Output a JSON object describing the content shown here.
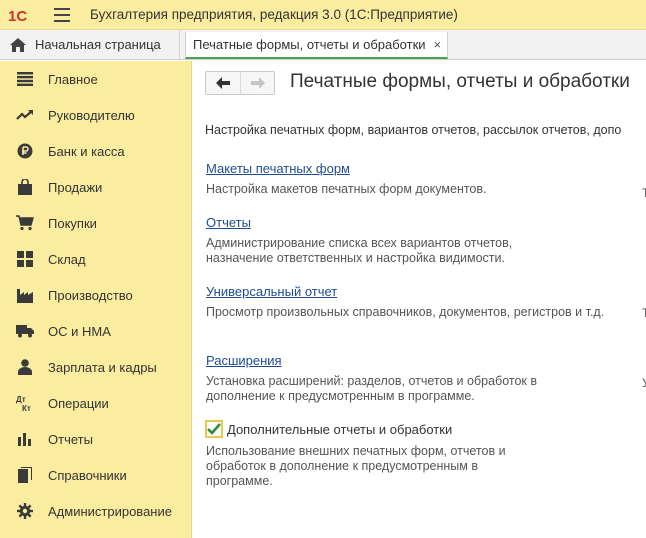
{
  "window": {
    "logo_text": "1С",
    "title": "Бухгалтерия предприятия, редакция 3.0  (1С:Предприятие)"
  },
  "tabs": {
    "home_label": "Начальная страница",
    "active_label": "Печатные формы, отчеты и обработки",
    "close_symbol": "×"
  },
  "sidebar": {
    "items": [
      {
        "label": "Главное",
        "icon": "menu-lines-icon"
      },
      {
        "label": "Руководителю",
        "icon": "trend-icon"
      },
      {
        "label": "Банк и касса",
        "icon": "ruble-coin-icon"
      },
      {
        "label": "Продажи",
        "icon": "shopping-bag-icon"
      },
      {
        "label": "Покупки",
        "icon": "cart-icon"
      },
      {
        "label": "Склад",
        "icon": "warehouse-grid-icon"
      },
      {
        "label": "Производство",
        "icon": "factory-icon"
      },
      {
        "label": "ОС и НМА",
        "icon": "truck-icon"
      },
      {
        "label": "Зарплата и кадры",
        "icon": "person-icon"
      },
      {
        "label": "Операции",
        "icon": "dt-kt-icon"
      },
      {
        "label": "Отчеты",
        "icon": "bar-chart-icon"
      },
      {
        "label": "Справочники",
        "icon": "books-icon"
      },
      {
        "label": "Администрирование",
        "icon": "gear-icon"
      }
    ],
    "dt_text": "Дт",
    "kt_text": "Кт"
  },
  "main": {
    "title": "Печатные формы, отчеты и обработки",
    "description": "Настройка печатных форм, вариантов отчетов, рассылок отчетов, допо",
    "sections": [
      {
        "link": "Макеты печатных форм",
        "note": [
          "Настройка макетов печатных форм документов."
        ]
      },
      {
        "link": "Отчеты",
        "note": [
          "Администрирование списка всех вариантов отчетов,",
          "назначение ответственных и настройка видимости."
        ]
      },
      {
        "link": "Универсальный отчет",
        "note": [
          "Просмотр произвольных справочников, документов, регистров и т.д."
        ]
      },
      {
        "link": "Расширения",
        "note": [
          "Установка расширений: разделов, отчетов и обработок в",
          "дополнение к предусмотренным в программе."
        ]
      }
    ],
    "checkbox": {
      "label": "Дополнительные отчеты и обработки",
      "checked": true,
      "note": [
        "Использование внешних печатных форм, отчетов и",
        "обработок в дополнение к предусмотренным в",
        "программе."
      ]
    },
    "edge_marks": [
      "Т",
      "Т",
      "У"
    ]
  },
  "colors": {
    "accent_yellow": "#fbeda0",
    "link_blue": "#1f4c8f",
    "check_green": "#2e8b3a",
    "logo_red": "#d22f27"
  }
}
